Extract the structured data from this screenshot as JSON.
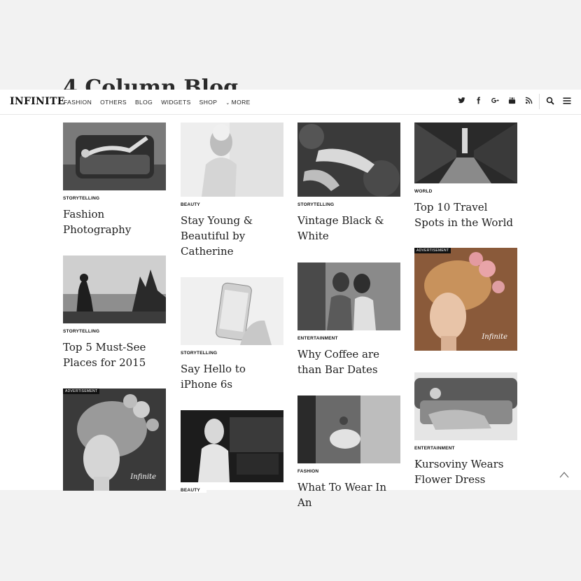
{
  "page": {
    "heading": "4 Column Blog"
  },
  "header": {
    "logo": "INFINITE",
    "nav": [
      "FASHION",
      "OTHERS",
      "BLOG",
      "WIDGETS",
      "SHOP",
      "MORE"
    ],
    "social_icons": [
      "twitter-icon",
      "facebook-icon",
      "google-plus-icon",
      "youtube-icon",
      "rss-icon"
    ],
    "utility_icons": [
      "search-icon",
      "menu-icon"
    ]
  },
  "posts": [
    {
      "category": "STORYTELLING",
      "title": "Fashion Photography"
    },
    {
      "category": "STORYTELLING",
      "title": "Top 5 Must-See Places for 2015"
    },
    {
      "advertisement": "ADVERTISEMENT",
      "ad_brand": "Infinite"
    },
    {
      "category": "BEAUTY",
      "title": "Stay Young & Beautiful by Catherine"
    },
    {
      "category": "STORYTELLING",
      "title": "Say Hello to iPhone 6s"
    },
    {
      "category": "BEAUTY"
    },
    {
      "category": "STORYTELLING",
      "title": "Vintage Black & White"
    },
    {
      "category": "ENTERTAINMENT",
      "title": "Why Coffee are than Bar Dates"
    },
    {
      "category": "FASHION",
      "title": "What To Wear In An"
    },
    {
      "category": "WORLD",
      "title": "Top 10 Travel Spots in the World"
    },
    {
      "advertisement": "ADVERTISEMENT",
      "ad_brand": "Infinite"
    },
    {
      "category": "ENTERTAINMENT",
      "title": "Kursoviny Wears Flower Dress"
    }
  ],
  "colors": {
    "text": "#1c1c1c",
    "background": "#ffffff",
    "outer": "#f2f2f2",
    "ad_warm": "#8a5a3a"
  }
}
